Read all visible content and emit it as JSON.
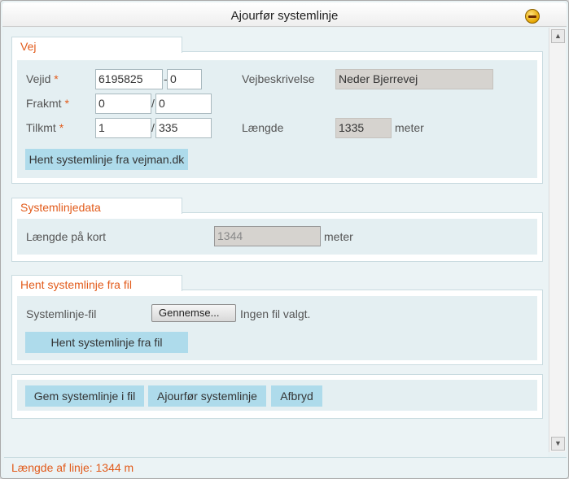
{
  "dialog": {
    "title": "Ajourfør systemlinje"
  },
  "vej": {
    "legend": "Vej",
    "vejid_label": "Vejid",
    "required_mark": "*",
    "vejid_value": "6195825",
    "vejid_sep": "-",
    "vejid_sub_value": "0",
    "frakmt_label": "Frakmt",
    "frakmt_value": "0",
    "frakmt_sep": "/",
    "frakmt_sub_value": "0",
    "tilkmt_label": "Tilkmt",
    "tilkmt_value": "1",
    "tilkmt_sep": "/",
    "tilkmt_sub_value": "335",
    "vejbeskrivelse_label": "Vejbeskrivelse",
    "vejbeskrivelse_value": "Neder Bjerrevej",
    "laengde_label": "Længde",
    "laengde_value": "1335",
    "laengde_unit": "meter",
    "fetch_button": "Hent systemlinje fra vejman.dk"
  },
  "systemlinjedata": {
    "legend": "Systemlinjedata",
    "laengde_kort_label": "Længde på kort",
    "laengde_kort_value": "1344",
    "unit": "meter"
  },
  "fil": {
    "legend": "Hent systemlinje fra fil",
    "file_label": "Systemlinje-fil",
    "browse_button": "Gennemse...",
    "no_file_text": "Ingen fil valgt.",
    "fetch_button": "Hent systemlinje fra fil"
  },
  "actions": {
    "save_button": "Gem systemlinje i fil",
    "update_button": "Ajourfør systemlinje",
    "cancel_button": "Afbryd"
  },
  "status": {
    "text": "Længde af linje: 1344 m"
  },
  "icons": {
    "minimize": "minimize-icon",
    "scroll_up": "scroll-up-icon",
    "scroll_down": "scroll-down-icon"
  },
  "colors": {
    "accent": "#e25b1b",
    "button": "#aedbeb",
    "panel": "#e4eff2",
    "readonly": "#d6d3cf"
  }
}
